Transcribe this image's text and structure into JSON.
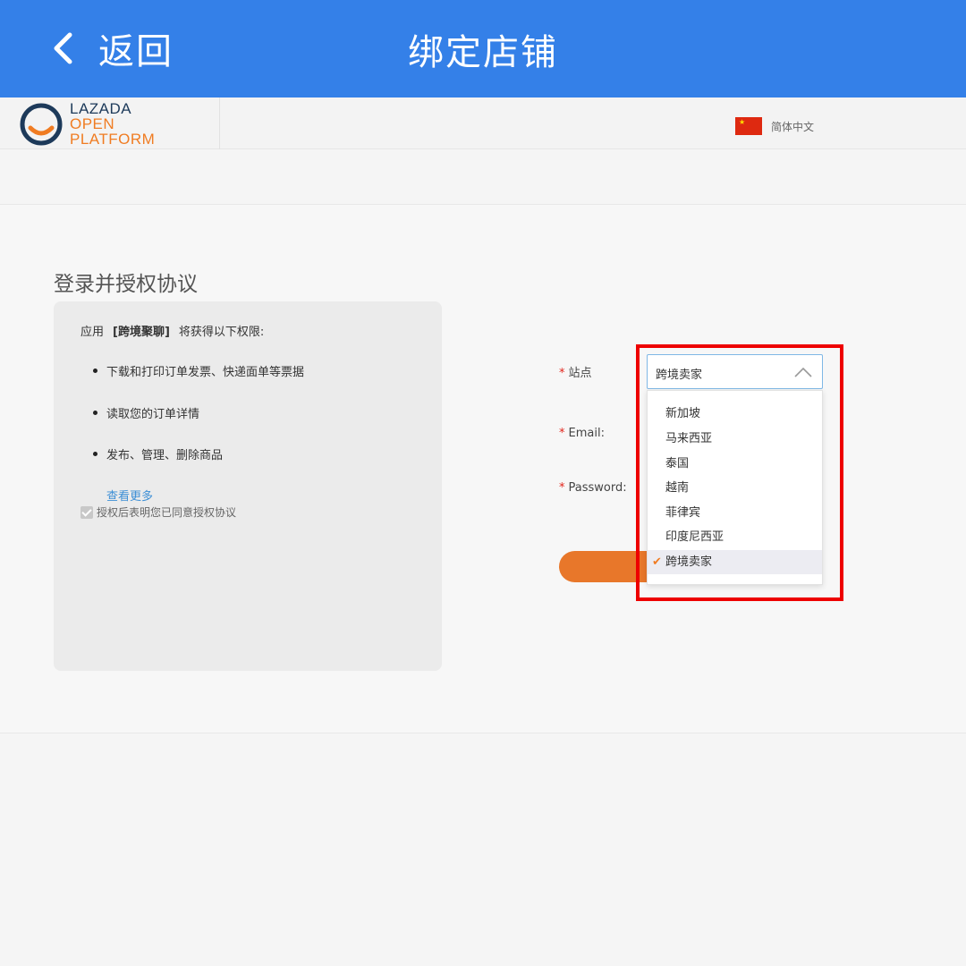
{
  "appbar": {
    "back_label": "返回",
    "title": "绑定店铺",
    "color": "#3480e8"
  },
  "site_header": {
    "logo_line1": "LAZADA",
    "logo_line2": "OPEN",
    "logo_line3": "PLATFORM",
    "language": "简体中文",
    "flag_icon": "china-flag-icon"
  },
  "auth": {
    "section_title": "登录并授权协议",
    "intro_prefix": "应用",
    "app_name": "[跨境聚聊]",
    "intro_suffix": "将获得以下权限:",
    "permissions": [
      "下载和打印订单发票、快递面单等票据",
      "读取您的订单详情",
      "发布、管理、删除商品"
    ],
    "more_link": "查看更多",
    "agree_text": "授权后表明您已同意授权协议"
  },
  "form": {
    "site_label": "站点",
    "email_label": "Email:",
    "password_label": "Password:",
    "required_mark": "*",
    "site_selected": "跨境卖家",
    "site_options": [
      "新加坡",
      "马来西亚",
      "泰国",
      "越南",
      "菲律宾",
      "印度尼西亚",
      "跨境卖家"
    ],
    "submit_color": "#e8772a"
  }
}
